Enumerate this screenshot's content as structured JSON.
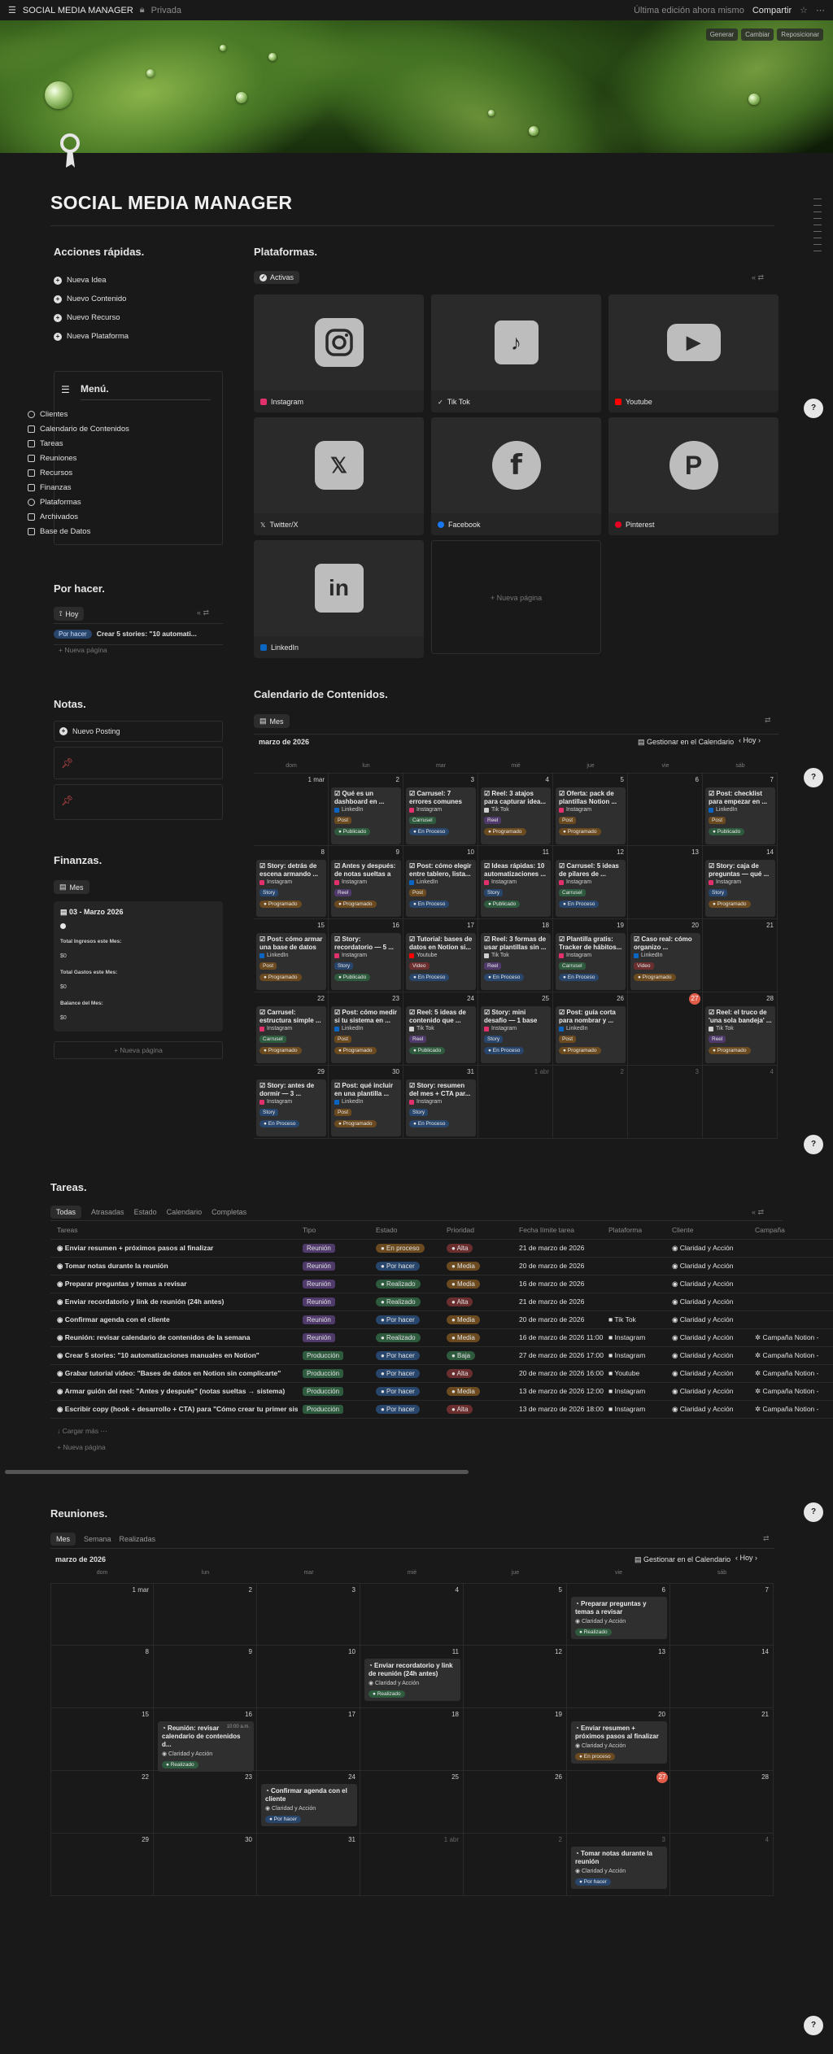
{
  "topbar": {
    "title": "SOCIAL MEDIA MANAGER",
    "privacy": "Privada",
    "edited": "Última edición ahora mismo",
    "share": "Compartir"
  },
  "cover": {
    "buttons": [
      "Generar",
      "Cambiar",
      "Reposicionar"
    ]
  },
  "page": {
    "title": "SOCIAL MEDIA MANAGER"
  },
  "quick": {
    "title": "Acciones rápidas.",
    "items": [
      "Nueva Idea",
      "Nuevo Contenido",
      "Nuevo Recurso",
      "Nueva Plataforma"
    ]
  },
  "menu": {
    "title": "Menú.",
    "items": [
      "Clientes",
      "Calendario de Contenidos",
      "Tareas",
      "Reuniones",
      "Recursos",
      "Finanzas",
      "Plataformas",
      "Archivados",
      "Base de Datos"
    ]
  },
  "todo": {
    "title": "Por hacer.",
    "view": "Hoy",
    "status": "Por hacer",
    "task": "Crear 5 stories: \"10 automati...",
    "new": "Nueva página"
  },
  "notes": {
    "title": "Notas.",
    "item": "Nuevo Posting"
  },
  "finance": {
    "title": "Finanzas.",
    "view": "Mes",
    "card": "03 - Marzo 2026",
    "l1": "Total Ingresos este Mes:",
    "v1": "$0",
    "l2": "Total Gastos este Mes:",
    "v2": "$0",
    "l3": "Balance del Mes:",
    "v3": "$0",
    "new": "Nueva página"
  },
  "platforms": {
    "title": "Plataformas.",
    "view": "Activas",
    "items": [
      {
        "name": "Instagram",
        "glyph": "◎",
        "color": "#e1306c"
      },
      {
        "name": "Tik Tok",
        "glyph": "♪",
        "color": "#cfcfcf"
      },
      {
        "name": "Youtube",
        "glyph": "▶",
        "color": "#ff0000"
      },
      {
        "name": "Twitter/X",
        "glyph": "𝕏",
        "color": "#cfcfcf"
      },
      {
        "name": "Facebook",
        "glyph": "f",
        "color": "#1877f2"
      },
      {
        "name": "Pinterest",
        "glyph": "P",
        "color": "#e60023"
      },
      {
        "name": "LinkedIn",
        "glyph": "in",
        "color": "#0a66c2"
      }
    ],
    "new": "Nueva página"
  },
  "calendar": {
    "title": "Calendario de Contenidos.",
    "view": "Mes",
    "month": "marzo de 2026",
    "manage": "Gestionar en el Calendario",
    "today": "Hoy",
    "dow": [
      "dom",
      "lun",
      "mar",
      "mié",
      "jue",
      "vie",
      "sáb"
    ],
    "weeks": [
      [
        {
          "d": "1 mar"
        },
        {
          "d": "2",
          "t": "Qué es un dashboard en ...",
          "p": "LinkedIn",
          "k": "Post",
          "s": "Publicado"
        },
        {
          "d": "3",
          "t": "Carrusel: 7 errores comunes a...",
          "p": "Instagram",
          "k": "Carrusel",
          "s": "En Proceso"
        },
        {
          "d": "4",
          "t": "Reel: 3 atajos para capturar idea...",
          "p": "Tik Tok",
          "k": "Reel",
          "s": "Programado"
        },
        {
          "d": "5",
          "t": "Oferta: pack de plantillas Notion ...",
          "p": "Instagram",
          "k": "Post",
          "s": "Programado"
        },
        {
          "d": "6"
        },
        {
          "d": "7",
          "t": "Post: checklist para empezar en ...",
          "p": "LinkedIn",
          "k": "Post",
          "s": "Publicado"
        }
      ],
      [
        {
          "d": "8",
          "t": "Story: detrás de escena armando ...",
          "p": "Instagram",
          "k": "Story",
          "s": "Programado"
        },
        {
          "d": "9",
          "t": "Antes y después: de notas sueltas a ...",
          "p": "Instagram",
          "k": "Reel",
          "s": "Programado"
        },
        {
          "d": "10",
          "t": "Post: cómo elegir entre tablero, lista...",
          "p": "LinkedIn",
          "k": "Post",
          "s": "En Proceso"
        },
        {
          "d": "11",
          "t": "Ideas rápidas: 10 automatizaciones ...",
          "p": "Instagram",
          "k": "Story",
          "s": "Publicado"
        },
        {
          "d": "12",
          "t": "Carrusel: 5 ideas de pilares de ...",
          "p": "Instagram",
          "k": "Carrusel",
          "s": "En Proceso"
        },
        {
          "d": "13"
        },
        {
          "d": "14",
          "t": "Story: caja de preguntas — qué ...",
          "p": "Instagram",
          "k": "Story",
          "s": "Programado"
        }
      ],
      [
        {
          "d": "15",
          "t": "Post: cómo armar una base de datos ...",
          "p": "LinkedIn",
          "k": "Post",
          "s": "Programado"
        },
        {
          "d": "16",
          "t": "Story: recordatorio — 5 ...",
          "p": "Instagram",
          "k": "Story",
          "s": "Publicado"
        },
        {
          "d": "17",
          "t": "Tutorial: bases de datos en Notion si...",
          "p": "Youtube",
          "k": "Video",
          "s": "En Proceso"
        },
        {
          "d": "18",
          "t": "Reel: 3 formas de usar plantillas sin ...",
          "p": "Tik Tok",
          "k": "Reel",
          "s": "En Proceso"
        },
        {
          "d": "19",
          "t": "Plantilla gratis: Tracker de hábitos...",
          "p": "Instagram",
          "k": "Carrusel",
          "s": "En Proceso"
        },
        {
          "d": "20",
          "t": "Caso real: cómo organizo ...",
          "p": "LinkedIn",
          "k": "Video",
          "s": "Programado"
        },
        {
          "d": "21"
        }
      ],
      [
        {
          "d": "22",
          "t": "Carrusel: estructura simple ...",
          "p": "Instagram",
          "k": "Carrusel",
          "s": "Programado"
        },
        {
          "d": "23",
          "t": "Post: cómo medir si tu sistema en ...",
          "p": "LinkedIn",
          "k": "Post",
          "s": "Programado"
        },
        {
          "d": "24",
          "t": "Reel: 5 ideas de contenido que ...",
          "p": "Tik Tok",
          "k": "Reel",
          "s": "Publicado"
        },
        {
          "d": "25",
          "t": "Story: mini desafío — 1 base d...",
          "p": "Instagram",
          "k": "Story",
          "s": "En Proceso"
        },
        {
          "d": "26",
          "t": "Post: guía corta para nombrar y ...",
          "p": "LinkedIn",
          "k": "Post",
          "s": "Programado"
        },
        {
          "d": "27",
          "today": true
        },
        {
          "d": "28",
          "t": "Reel: el truco de 'una sola bandeja' ...",
          "p": "Tik Tok",
          "k": "Reel",
          "s": "Programado"
        }
      ],
      [
        {
          "d": "29",
          "t": "Story: antes de dormir — 3 ...",
          "p": "Instagram",
          "k": "Story",
          "s": "En Proceso"
        },
        {
          "d": "30",
          "t": "Post: qué incluir en una plantilla ...",
          "p": "LinkedIn",
          "k": "Post",
          "s": "Programado"
        },
        {
          "d": "31",
          "t": "Story: resumen del mes + CTA par...",
          "p": "Instagram",
          "k": "Story",
          "s": "En Proceso"
        },
        {
          "d": "1 abr",
          "o": true
        },
        {
          "d": "2",
          "o": true
        },
        {
          "d": "3",
          "o": true
        },
        {
          "d": "4",
          "o": true
        }
      ]
    ]
  },
  "tasks": {
    "title": "Tareas.",
    "views": [
      "Todas",
      "Atrasadas",
      "Estado",
      "Calendario",
      "Completas"
    ],
    "cols": [
      "Tareas",
      "Tipo",
      "Estado",
      "Prioridad",
      "Fecha límite tarea",
      "Plataforma",
      "Cliente",
      "Campaña"
    ],
    "rows": [
      [
        "Enviar resumen + próximos pasos al finalizar",
        "Reunión",
        "En proceso",
        "Alta",
        "21 de marzo de 2026",
        "",
        "Claridad y Acción",
        ""
      ],
      [
        "Tomar notas durante la reunión",
        "Reunión",
        "Por hacer",
        "Media",
        "20 de marzo de 2026",
        "",
        "Claridad y Acción",
        ""
      ],
      [
        "Preparar preguntas y temas a revisar",
        "Reunión",
        "Realizado",
        "Media",
        "16 de marzo de 2026",
        "",
        "Claridad y Acción",
        ""
      ],
      [
        "Enviar recordatorio y link de reunión (24h antes)",
        "Reunión",
        "Realizado",
        "Alta",
        "21 de marzo de 2026",
        "",
        "Claridad y Acción",
        ""
      ],
      [
        "Confirmar agenda con el cliente",
        "Reunión",
        "Por hacer",
        "Media",
        "20 de marzo de 2026",
        "Tik Tok",
        "Claridad y Acción",
        ""
      ],
      [
        "Reunión: revisar calendario de contenidos de la semana",
        "Reunión",
        "Realizado",
        "Media",
        "16 de marzo de 2026 11:00",
        "Instagram",
        "Claridad y Acción",
        "Campaña Notion -"
      ],
      [
        "Crear 5 stories: \"10 automatizaciones manuales en Notion\"",
        "Producción",
        "Por hacer",
        "Baja",
        "27 de marzo de 2026 17:00",
        "Instagram",
        "Claridad y Acción",
        "Campaña Notion -"
      ],
      [
        "Grabar tutorial video: \"Bases de datos en Notion sin complicarte\"",
        "Producción",
        "Por hacer",
        "Alta",
        "20 de marzo de 2026 16:00",
        "Youtube",
        "Claridad y Acción",
        "Campaña Notion -"
      ],
      [
        "Armar guión del reel: \"Antes y después\" (notas sueltas → sistema)",
        "Producción",
        "Por hacer",
        "Media",
        "13 de marzo de 2026 12:00",
        "Instagram",
        "Claridad y Acción",
        "Campaña Notion -"
      ],
      [
        "Escribir copy (hook + desarrollo + CTA) para \"Cómo crear tu primer sistema\"",
        "Producción",
        "Por hacer",
        "Alta",
        "13 de marzo de 2026 18:00",
        "Instagram",
        "Claridad y Acción",
        "Campaña Notion -"
      ]
    ],
    "loadmore": "Cargar más",
    "new": "Nueva página"
  },
  "meetings": {
    "title": "Reuniones.",
    "views": [
      "Mes",
      "Semana",
      "Realizadas"
    ],
    "month": "marzo de 2026",
    "manage": "Gestionar en el Calendario",
    "today": "Hoy",
    "dow": [
      "dom",
      "lun",
      "mar",
      "mié",
      "jue",
      "vie",
      "sáb"
    ],
    "weeks": [
      [
        {
          "d": "1 mar"
        },
        {
          "d": "2"
        },
        {
          "d": "3"
        },
        {
          "d": "4"
        },
        {
          "d": "5"
        },
        {
          "d": "6",
          "t": "Preparar preguntas y temas a revisar",
          "c": "Claridad y Acción",
          "s": "Realizado"
        },
        {
          "d": "7"
        }
      ],
      [
        {
          "d": "8"
        },
        {
          "d": "9"
        },
        {
          "d": "10"
        },
        {
          "d": "11",
          "t": "Enviar recordatorio y link de reunión (24h antes)",
          "c": "Claridad y Acción",
          "s": "Realizado"
        },
        {
          "d": "12"
        },
        {
          "d": "13"
        },
        {
          "d": "14"
        }
      ],
      [
        {
          "d": "15"
        },
        {
          "d": "16",
          "t": "Reunión: revisar calendario de contenidos d...",
          "time": "10:00 a.m.",
          "c": "Claridad y Acción",
          "s": "Realizado"
        },
        {
          "d": "17"
        },
        {
          "d": "18"
        },
        {
          "d": "19"
        },
        {
          "d": "20",
          "t": "Enviar resumen + próximos pasos al finalizar",
          "c": "Claridad y Acción",
          "s": "En proceso"
        },
        {
          "d": "21"
        }
      ],
      [
        {
          "d": "22"
        },
        {
          "d": "23"
        },
        {
          "d": "24",
          "t": "Confirmar agenda con el cliente",
          "c": "Claridad y Acción",
          "s": "Por hacer"
        },
        {
          "d": "25"
        },
        {
          "d": "26"
        },
        {
          "d": "27",
          "today": true
        },
        {
          "d": "28"
        }
      ],
      [
        {
          "d": "29"
        },
        {
          "d": "30"
        },
        {
          "d": "31"
        },
        {
          "d": "1 abr",
          "o": true
        },
        {
          "d": "2",
          "o": true
        },
        {
          "d": "3",
          "o": true,
          "t": "Tomar notas durante la reunión",
          "c": "Claridad y Acción",
          "s": "Por hacer"
        },
        {
          "d": "4",
          "o": true
        }
      ]
    ]
  }
}
